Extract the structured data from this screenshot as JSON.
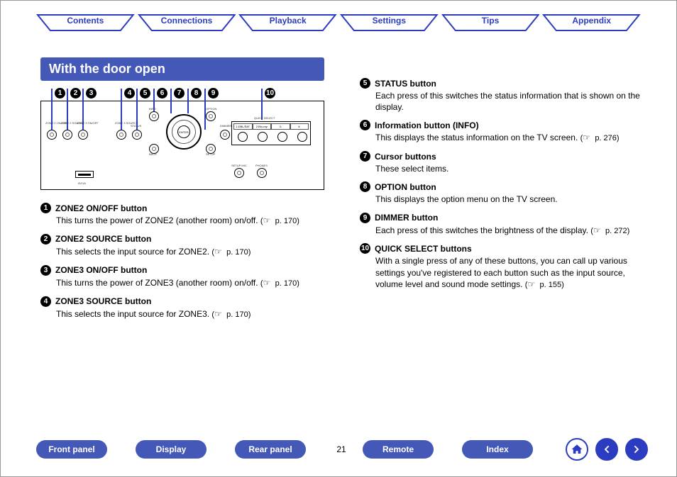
{
  "top_nav": {
    "items": [
      "Contents",
      "Connections",
      "Playback",
      "Settings",
      "Tips",
      "Appendix"
    ]
  },
  "section_title": "With the door open",
  "diagram": {
    "markers": [
      "1",
      "2",
      "3",
      "4",
      "5",
      "6",
      "7",
      "8",
      "9",
      "10"
    ],
    "knob_labels": {
      "zone2_onoff": "ZONE 2\nON/OFF",
      "zone2_source": "ZONE 2\nSOURCE",
      "zone3_onoff": "ZONE 3\nON/OFF",
      "zone3_source": "ZONE 3\nSOURCE",
      "status": "STATUS",
      "info": "INFO",
      "option": "OPTION",
      "back": "BACK",
      "setup": "SETUP",
      "dimmer": "DIMMER",
      "setup_mic": "SETUP MIC",
      "phones": "PHONES",
      "enter": "ENTER",
      "usb": "5V/1A",
      "qs_title": "QUICK SELECT",
      "qs_1": "1:DBL/SAT",
      "qs_2": "2:Blu-ray",
      "qs_3": "3:",
      "qs_4": "4:"
    }
  },
  "descriptions_left": [
    {
      "n": "1",
      "title": "ZONE2 ON/OFF button",
      "body": "This turns the power of ZONE2 (another room) on/off.",
      "ref": "p. 170"
    },
    {
      "n": "2",
      "title": "ZONE2 SOURCE button",
      "body": "This selects the input source for ZONE2.",
      "ref": "p. 170"
    },
    {
      "n": "3",
      "title": "ZONE3 ON/OFF button",
      "body": "This turns the power of ZONE3 (another room) on/off.",
      "ref": "p. 170"
    },
    {
      "n": "4",
      "title": "ZONE3 SOURCE button",
      "body": "This selects the input source for ZONE3.",
      "ref": "p. 170"
    }
  ],
  "descriptions_right": [
    {
      "n": "5",
      "title": "STATUS button",
      "body": "Each press of this switches the status information that is shown on the display.",
      "ref": null
    },
    {
      "n": "6",
      "title": "Information button (INFO)",
      "body": "This displays the status information on the TV screen.",
      "ref": "p. 276"
    },
    {
      "n": "7",
      "title": "Cursor buttons",
      "body": "These select items.",
      "ref": null
    },
    {
      "n": "8",
      "title": "OPTION button",
      "body": "This displays the option menu on the TV screen.",
      "ref": null
    },
    {
      "n": "9",
      "title": "DIMMER button",
      "body": "Each press of this switches the brightness of the display.",
      "ref": "p. 272"
    },
    {
      "n": "10",
      "title": "QUICK SELECT buttons",
      "body": "With a single press of any of these buttons, you can call up various settings you've registered to each button such as the input source, volume level and sound mode settings.",
      "ref": "p. 155"
    }
  ],
  "bottom_nav": {
    "pills": [
      "Front panel",
      "Display",
      "Rear panel"
    ],
    "page": "21",
    "pills2": [
      "Remote",
      "Index"
    ],
    "icons": {
      "home": "home-icon",
      "prev": "arrow-left-icon",
      "next": "arrow-right-icon"
    }
  }
}
